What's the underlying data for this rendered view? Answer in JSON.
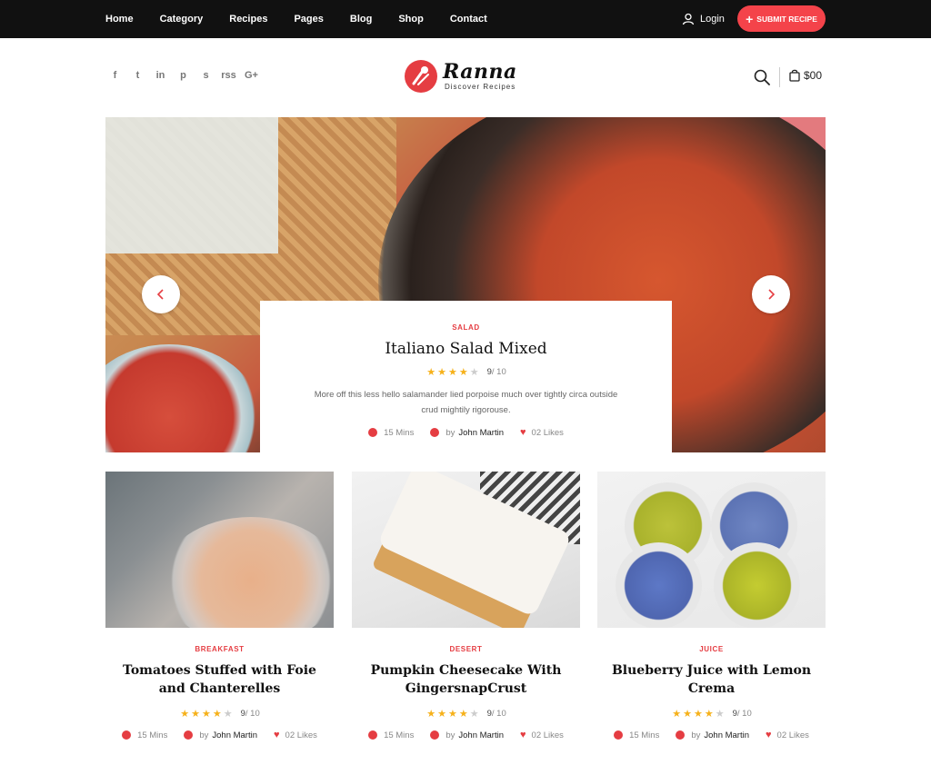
{
  "nav": {
    "items": [
      "Home",
      "Category",
      "Recipes",
      "Pages",
      "Blog",
      "Shop",
      "Contact"
    ],
    "login_label": "Login",
    "submit_label": "SUBMIT RECIPE"
  },
  "header": {
    "socials": [
      "f",
      "t",
      "in",
      "p",
      "s",
      "rss",
      "G+"
    ],
    "logo": {
      "name": "Ranna",
      "tagline": "Discover Recipes"
    },
    "cart_total": "$00"
  },
  "hero": {
    "category": "SALAD",
    "title": "Italiano Salad Mixed",
    "rating": {
      "stars": 4,
      "max_stars": 5,
      "score": "9",
      "out_of": "/ 10"
    },
    "description": "More off this less hello salamander lied porpoise much over tightly circa outside crud mightily rigorouse.",
    "time": "15 Mins",
    "by": "by",
    "author": "John Martin",
    "likes": "02 Likes"
  },
  "cards": [
    {
      "category": "BREAKFAST",
      "title": "Tomatoes Stuffed with Foie and Chanterelles",
      "rating": {
        "stars": 4,
        "max_stars": 5,
        "score": "9",
        "out_of": "/ 10"
      },
      "time": "15 Mins",
      "by": "by",
      "author": "John Martin",
      "likes": "02 Likes"
    },
    {
      "category": "DESERT",
      "title": "Pumpkin Cheesecake With GingersnapCrust",
      "rating": {
        "stars": 4,
        "max_stars": 5,
        "score": "9",
        "out_of": "/ 10"
      },
      "time": "15 Mins",
      "by": "by",
      "author": "John Martin",
      "likes": "02 Likes"
    },
    {
      "category": "JUICE",
      "title": "Blueberry Juice with Lemon Crema",
      "rating": {
        "stars": 4,
        "max_stars": 5,
        "score": "9",
        "out_of": "/ 10"
      },
      "time": "15 Mins",
      "by": "by",
      "author": "John Martin",
      "likes": "02 Likes"
    }
  ],
  "colors": {
    "accent": "#e53d42",
    "topbar": "#111111",
    "star": "#f6b11a",
    "star_off": "#cccccc"
  }
}
